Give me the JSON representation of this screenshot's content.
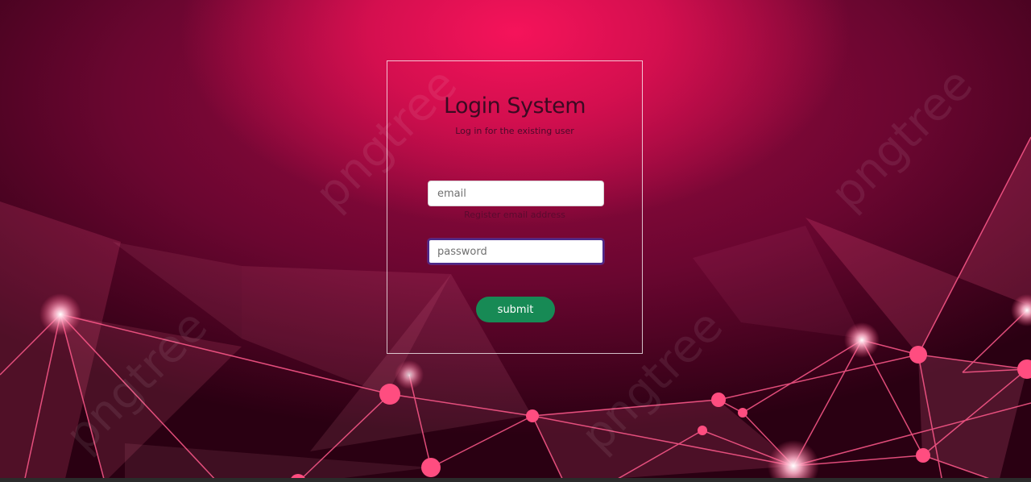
{
  "login": {
    "title": "Login System",
    "subtitle": "Log in for the existing user",
    "email_placeholder": "email",
    "email_help": "Register email address",
    "password_placeholder": "password",
    "submit_label": "submit"
  },
  "watermark": {
    "text": "pngtree"
  },
  "colors": {
    "background_primary": "#d40f4f",
    "background_dark": "#2a0012",
    "submit_button": "#178a55",
    "title_text": "#3b0a22",
    "network_lines": "#ff5a8c"
  }
}
